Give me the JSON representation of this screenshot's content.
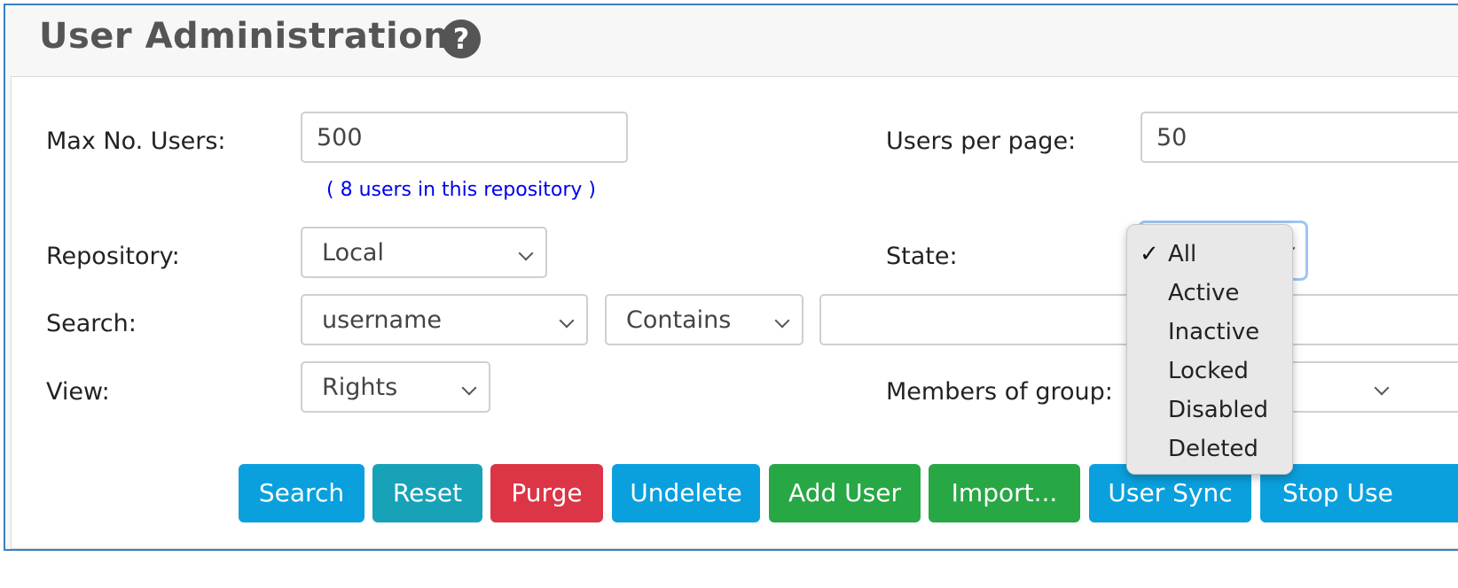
{
  "header": {
    "title": "User Administration",
    "help_icon": "?"
  },
  "form": {
    "max_users_label": "Max No. Users:",
    "max_users_value": "500",
    "repo_info": "( 8  users in this repository )",
    "users_per_page_label": "Users per page:",
    "users_per_page_value": "50",
    "repository_label": "Repository:",
    "repository_value": "Local",
    "state_label": "State:",
    "search_label": "Search:",
    "search_field_value": "username",
    "search_operator_value": "Contains",
    "search_text_value": "",
    "view_label": "View:",
    "view_value": "Rights",
    "members_label": "Members of group:"
  },
  "state_dropdown": {
    "selected": "All",
    "checkmark": "✓",
    "options": [
      "All",
      "Active",
      "Inactive",
      "Locked",
      "Disabled",
      "Deleted"
    ]
  },
  "buttons": {
    "search": "Search",
    "reset": "Reset",
    "purge": "Purge",
    "undelete": "Undelete",
    "add_user": "Add User",
    "import": "Import...",
    "user_sync": "User Sync",
    "stop_user_sync": "Stop Use"
  },
  "colors": {
    "blue": "#0aa0dd",
    "teal": "#17a2b8",
    "red": "#dc3545",
    "green": "#28a745",
    "link": "#0000ee"
  }
}
